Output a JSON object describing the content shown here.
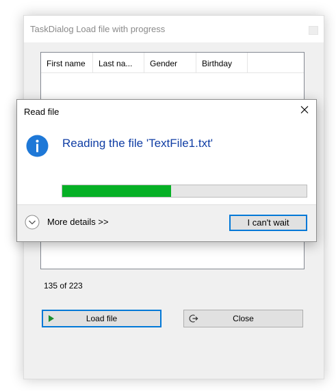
{
  "main_window": {
    "title": "TaskDialog Load file with progress",
    "columns": [
      "First name",
      "Last na...",
      "Gender",
      "Birthday"
    ],
    "count_text": "135 of 223",
    "load_button_label": "Load file",
    "close_button_label": "Close"
  },
  "task_dialog": {
    "title": "Read file",
    "main_instruction": "Reading the file 'TextFile1.txt'",
    "progress": 0.445,
    "expand_label": "More details >>",
    "button_label": "I can't wait"
  },
  "colors": {
    "progress_fill": "#06b025",
    "instruction_text": "#0f3da4",
    "focus_border": "#0078d7",
    "info_icon": "#1e78d7"
  },
  "icons": {
    "info": "info-icon",
    "dialog_close": "close-icon",
    "expand": "chevron-down-icon",
    "load": "play-icon",
    "exit": "exit-icon"
  }
}
